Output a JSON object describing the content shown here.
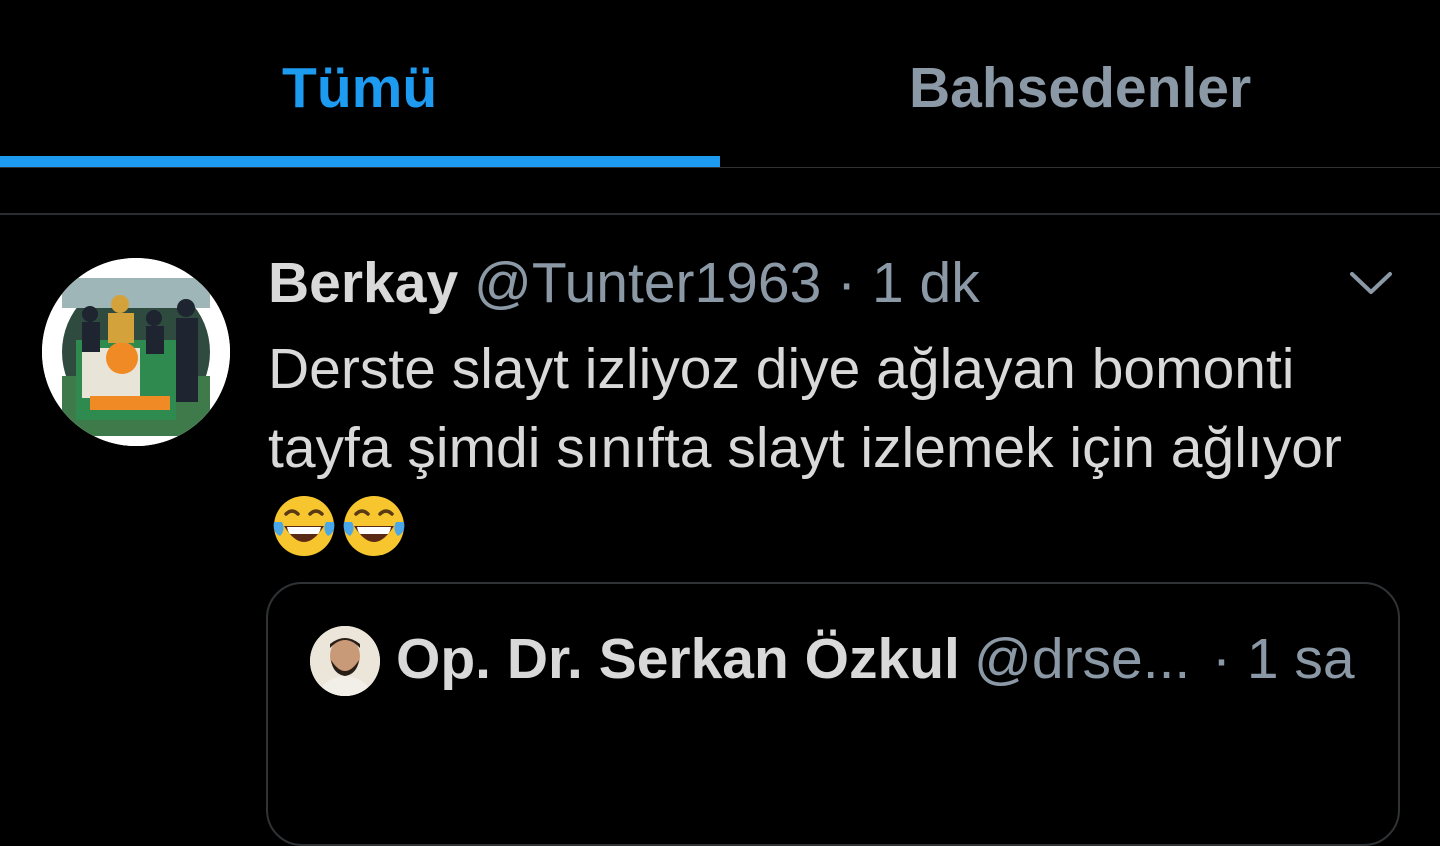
{
  "tabs": [
    {
      "label": "Tümü",
      "active": true
    },
    {
      "label": "Bahsedenler",
      "active": false
    }
  ],
  "colors": {
    "accent": "#1d9bf0",
    "background": "#000000",
    "secondary_text": "#8b98a5",
    "primary_text": "#d9d9d9",
    "divider": "#2f3336"
  },
  "tweet": {
    "display_name": "Berkay",
    "handle": "@Tunter1963",
    "separator": "·",
    "time": "1 dk",
    "text": "Derste slayt izliyoz diye ağlayan bomonti tayfa şimdi sınıfta slayt izlemek için ağlıyor",
    "emojis": [
      "face-with-tears-of-joy",
      "face-with-tears-of-joy"
    ],
    "menu_icon": "chevron-down-icon"
  },
  "quote": {
    "display_name": "Op. Dr. Serkan Özkul",
    "handle": "@drse...",
    "separator": "·",
    "time": "1 sa"
  }
}
